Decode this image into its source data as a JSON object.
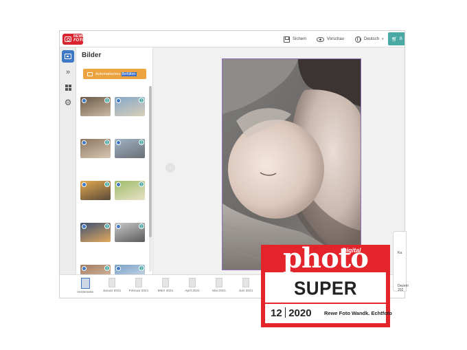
{
  "header": {
    "logo_top": "REWE",
    "logo_bottom": "FOTO",
    "save_label": "Sichern",
    "preview_label": "Vorschau",
    "language_label": "Deutsch",
    "cart_label": "B"
  },
  "sidebar": {
    "panel_title": "Bilder",
    "auto_fill_label_a": "Automatisches",
    "auto_fill_label_b": "Befüllen"
  },
  "thumbnails": [
    {
      "badge": "1",
      "colors": [
        "#6b5a48",
        "#cbb9a4"
      ]
    },
    {
      "badge": "1",
      "colors": [
        "#86a7c8",
        "#d9cfb8"
      ]
    },
    {
      "badge": "1",
      "colors": [
        "#8b7560",
        "#d8c7b2"
      ]
    },
    {
      "badge": "1",
      "colors": [
        "#9fb2c4",
        "#6a6f75"
      ]
    },
    {
      "badge": "1",
      "colors": [
        "#e4a94f",
        "#5a4a3a"
      ]
    },
    {
      "badge": "1",
      "colors": [
        "#9dbb6a",
        "#e9e2c6"
      ]
    },
    {
      "badge": "1",
      "colors": [
        "#3d5273",
        "#e3a85d"
      ]
    },
    {
      "badge": "1",
      "colors": [
        "#c8c8c8",
        "#5b5b5b"
      ]
    },
    {
      "badge": "1",
      "colors": [
        "#a27a60",
        "#e0c9b0"
      ]
    },
    {
      "badge": "1",
      "colors": [
        "#7aa0c7",
        "#dde6ee"
      ]
    }
  ],
  "months": [
    {
      "label": "Vorderseite",
      "selected": true
    },
    {
      "label": "Januar 2021",
      "selected": false
    },
    {
      "label": "Februar 2021",
      "selected": false
    },
    {
      "label": "März 2021",
      "selected": false
    },
    {
      "label": "April 2021",
      "selected": false
    },
    {
      "label": "Mai 2021",
      "selected": false
    },
    {
      "label": "Juni 2021",
      "selected": false
    }
  ],
  "side_card": {
    "line1": "Ka",
    "line2": "Dezem",
    "line3": "202"
  },
  "award": {
    "brand_small": "Digital",
    "brand": "photo",
    "rating": "SUPER",
    "issue": "12",
    "year": "2020",
    "product": "Rewe Foto Wandk. Echtfoto"
  },
  "colors": {
    "brand_red": "#e3252b",
    "accent_blue": "#3f78c4",
    "auto_orange": "#eda33f",
    "cart_teal": "#4aa9a4",
    "page_border": "#8c6db6"
  }
}
